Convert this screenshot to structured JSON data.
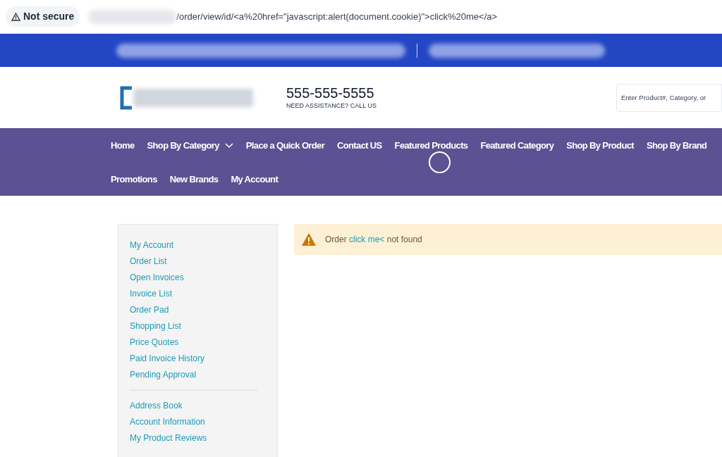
{
  "address_bar": {
    "security": "Not secure",
    "url": "/order/view/id/<a%20href=\"javascript:alert(document.cookie)\">click%20me</a>"
  },
  "header": {
    "phone": "555-555-5555",
    "assistance": "NEED ASSISTANCE? CALL US",
    "search": {
      "placeholder": "Enter Product#, Category, or"
    }
  },
  "nav": {
    "items": [
      {
        "label": "Home",
        "has_dropdown": false
      },
      {
        "label": "Shop By Category",
        "has_dropdown": true
      },
      {
        "label": "Place a Quick Order",
        "has_dropdown": false
      },
      {
        "label": "Contact US",
        "has_dropdown": false
      },
      {
        "label": "Featured Products",
        "has_dropdown": false
      },
      {
        "label": "Featured Category",
        "has_dropdown": false
      },
      {
        "label": "Shop By Product",
        "has_dropdown": false
      },
      {
        "label": "Shop By Brand",
        "has_dropdown": false
      },
      {
        "label": "Promotions",
        "has_dropdown": false
      },
      {
        "label": "New Brands",
        "has_dropdown": false
      },
      {
        "label": "My Account",
        "has_dropdown": false
      }
    ]
  },
  "sidebar": {
    "groups": [
      {
        "items": [
          "My Account",
          "Order List",
          "Open Invoices",
          "Invoice List",
          "Order Pad",
          "Shopping List",
          "Price Quotes",
          "Paid Invoice History",
          "Pending Approval"
        ]
      },
      {
        "items": [
          "Address Book",
          "Account Information",
          "My Product Reviews"
        ]
      }
    ]
  },
  "alert": {
    "prefix": "Order",
    "link": "click me<",
    "suffix": "not found"
  }
}
